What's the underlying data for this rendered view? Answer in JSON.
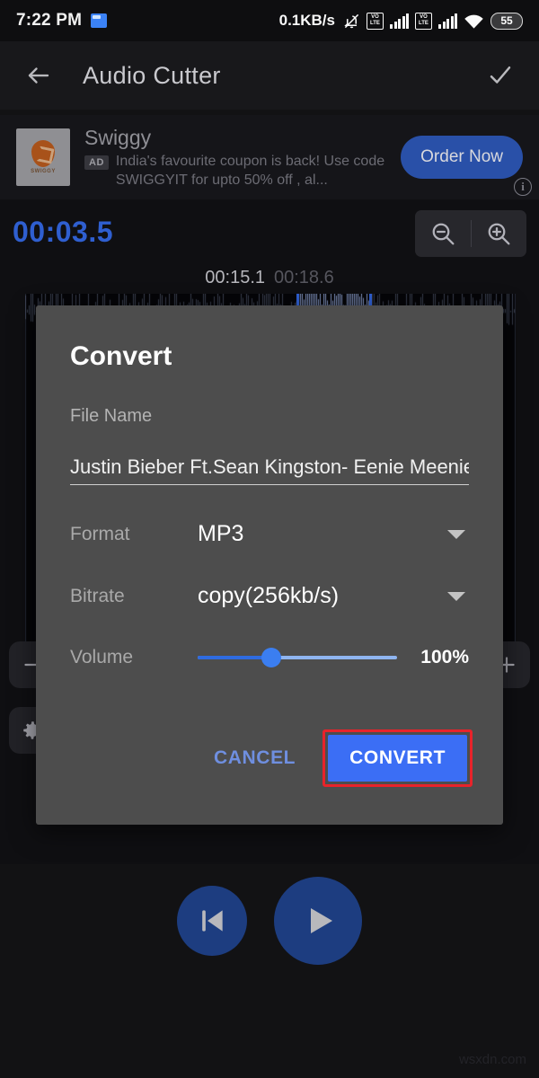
{
  "status_bar": {
    "time": "7:22 PM",
    "app_icon": "folder-icon",
    "network_speed": "0.1KB/s",
    "mute_icon": "bell-muted-icon",
    "volte_label_top": "VO",
    "volte_label_bottom": "LTE",
    "signal_icon": "signal-bars-icon",
    "wifi_icon": "wifi-icon",
    "battery_level": "55"
  },
  "app_bar": {
    "back_icon": "back-arrow-icon",
    "title": "Audio Cutter",
    "confirm_icon": "check-icon"
  },
  "ad": {
    "advertiser": "Swiggy",
    "badge": "AD",
    "description": "India's favourite coupon is back! Use code SWIGGYIT for upto 50% off , al...",
    "cta_label": "Order Now",
    "logo_text": "SWIGGY",
    "info_icon": "ad-info-icon"
  },
  "editor": {
    "current_time": "00:03.5",
    "selection_start": "00:15.1",
    "selection_end": "00:18.6",
    "zoom_out_icon": "zoom-out-icon",
    "zoom_in_icon": "zoom-in-icon",
    "minus_icon": "minus-icon",
    "settings_icon": "gear-icon",
    "plus_icon": "plus-icon"
  },
  "playback": {
    "previous_icon": "skip-previous-icon",
    "play_icon": "play-icon"
  },
  "dialog": {
    "title": "Convert",
    "file_name_label": "File Name",
    "file_name_value": "Justin Bieber Ft.Sean Kingston- Eenie Meenie",
    "format_label": "Format",
    "format_value": "MP3",
    "bitrate_label": "Bitrate",
    "bitrate_value": "copy(256kb/s)",
    "volume_label": "Volume",
    "volume_value": "100%",
    "cancel_label": "CANCEL",
    "convert_label": "CONVERT",
    "highlight_color": "#e8232a",
    "accent_color": "#3b6ef5"
  },
  "watermark": "wsxdn.com"
}
